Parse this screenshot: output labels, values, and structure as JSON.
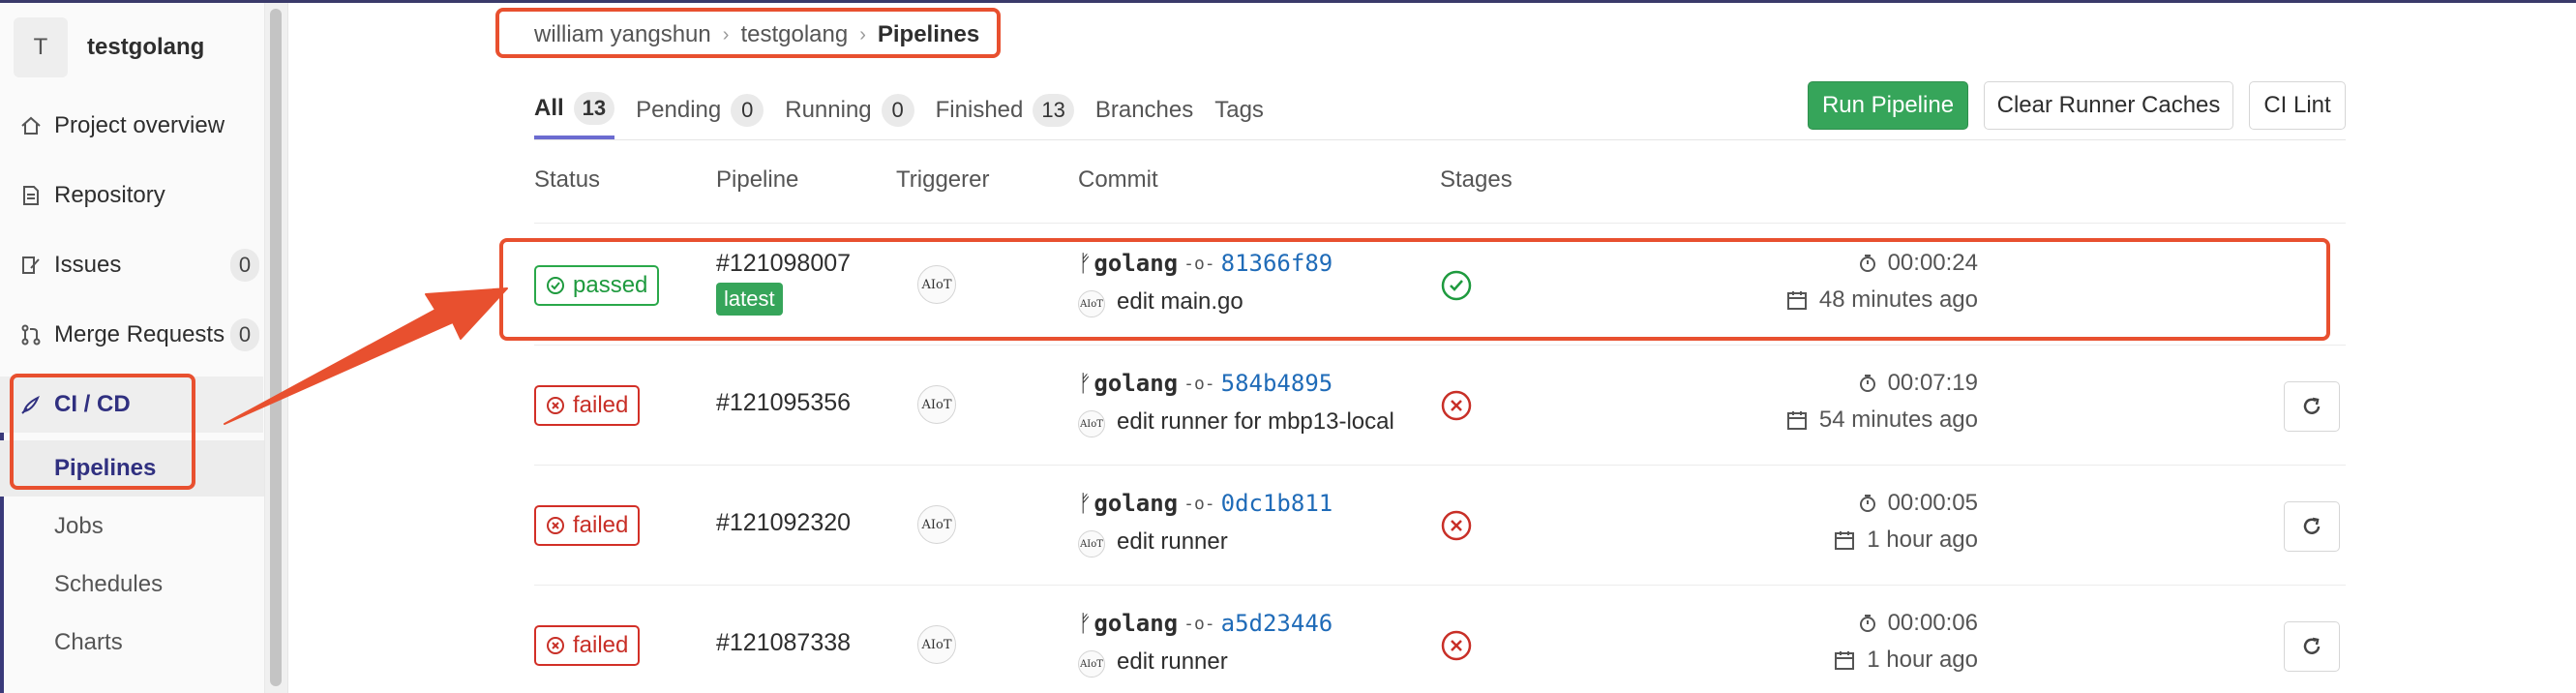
{
  "sidebar": {
    "project_avatar": "T",
    "project_name": "testgolang",
    "items": [
      {
        "label": "Project overview",
        "icon": "home-icon"
      },
      {
        "label": "Repository",
        "icon": "document-icon"
      },
      {
        "label": "Issues",
        "icon": "issues-icon",
        "count": "0"
      },
      {
        "label": "Merge Requests",
        "icon": "merge-request-icon",
        "count": "0"
      },
      {
        "label": "CI / CD",
        "icon": "rocket-icon"
      }
    ],
    "sub_items": [
      "Pipelines",
      "Jobs",
      "Schedules",
      "Charts"
    ]
  },
  "breadcrumb": {
    "items": [
      "william yangshun",
      "testgolang"
    ],
    "current": "Pipelines"
  },
  "tabs": [
    {
      "label": "All",
      "count": "13"
    },
    {
      "label": "Pending",
      "count": "0"
    },
    {
      "label": "Running",
      "count": "0"
    },
    {
      "label": "Finished",
      "count": "13"
    },
    {
      "label": "Branches"
    },
    {
      "label": "Tags"
    }
  ],
  "buttons": {
    "run_pipeline": "Run Pipeline",
    "clear_cache": "Clear Runner Caches",
    "ci_lint": "CI Lint"
  },
  "columns": [
    "Status",
    "Pipeline",
    "Triggerer",
    "Commit",
    "Stages"
  ],
  "rows": [
    {
      "status": "passed",
      "id": "#121098007",
      "badge": "latest",
      "triggerer": "AIoT",
      "branch": "golang",
      "sha": "81366f89",
      "message": "edit main.go",
      "duration": "00:00:24",
      "finished": "48 minutes ago"
    },
    {
      "status": "failed",
      "id": "#121095356",
      "triggerer": "AIoT",
      "branch": "golang",
      "sha": "584b4895",
      "message": "edit runner for mbp13-local",
      "duration": "00:07:19",
      "finished": "54 minutes ago"
    },
    {
      "status": "failed",
      "id": "#121092320",
      "triggerer": "AIoT",
      "branch": "golang",
      "sha": "0dc1b811",
      "message": "edit runner",
      "duration": "00:00:05",
      "finished": "1 hour ago"
    },
    {
      "status": "failed",
      "id": "#121087338",
      "triggerer": "AIoT",
      "branch": "golang",
      "sha": "a5d23446",
      "message": "edit runner",
      "duration": "00:00:06",
      "finished": "1 hour ago"
    }
  ],
  "colors": {
    "accent": "#303080",
    "success": "#1e9a3e",
    "danger": "#c82f27",
    "annotation": "#e8502f",
    "run_button": "#36a55a"
  }
}
